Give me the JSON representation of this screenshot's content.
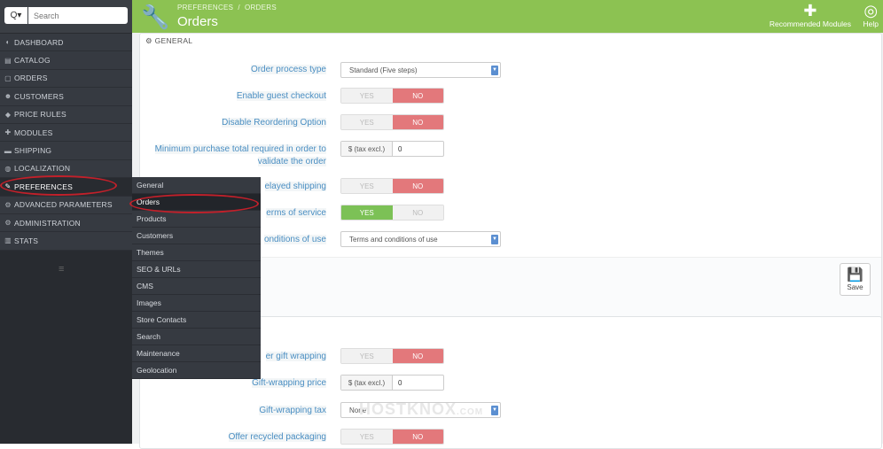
{
  "search": {
    "placeholder": "Search",
    "toggle": "Q▾"
  },
  "sidebar": {
    "items": [
      {
        "label": "DASHBOARD",
        "icon": "dashboard-icon",
        "glyph": "◐"
      },
      {
        "label": "CATALOG",
        "icon": "catalog-icon",
        "glyph": "▤"
      },
      {
        "label": "ORDERS",
        "icon": "orders-icon",
        "glyph": "▢"
      },
      {
        "label": "CUSTOMERS",
        "icon": "customers-icon",
        "glyph": "☻"
      },
      {
        "label": "PRICE RULES",
        "icon": "price-rules-icon",
        "glyph": "◆"
      },
      {
        "label": "MODULES",
        "icon": "modules-icon",
        "glyph": "✚"
      },
      {
        "label": "SHIPPING",
        "icon": "shipping-icon",
        "glyph": "▬"
      },
      {
        "label": "LOCALIZATION",
        "icon": "globe-icon",
        "glyph": "◍"
      },
      {
        "label": "PREFERENCES",
        "icon": "wrench-icon",
        "glyph": "🔧"
      },
      {
        "label": "ADVANCED PARAMETERS",
        "icon": "cogs-icon",
        "glyph": "⚙"
      },
      {
        "label": "ADMINISTRATION",
        "icon": "cog-icon",
        "glyph": "⚙"
      },
      {
        "label": "STATS",
        "icon": "stats-icon",
        "glyph": "▥"
      }
    ],
    "collapse": "≡"
  },
  "submenu": [
    "General",
    "Orders",
    "Products",
    "Customers",
    "Themes",
    "SEO & URLs",
    "CMS",
    "Images",
    "Store Contacts",
    "Search",
    "Maintenance",
    "Geolocation"
  ],
  "header": {
    "breadcrumb_1": "PREFERENCES",
    "breadcrumb_sep": "/",
    "breadcrumb_2": "ORDERS",
    "title": "Orders",
    "recommended": "Recommended Modules",
    "help": "Help",
    "accent": "#8cc252"
  },
  "general": {
    "heading": "GENERAL",
    "order_process_label": "Order process type",
    "order_process_value": "Standard (Five steps)",
    "guest_checkout_label": "Enable guest checkout",
    "reordering_label": "Disable Reordering Option",
    "min_purchase_label": "Minimum purchase total required in order to validate the order",
    "min_purchase_prefix": "$ (tax excl.)",
    "min_purchase_value": "0",
    "delayed_label": "elayed shipping",
    "terms_label": "erms of service",
    "conditions_label": "onditions of use",
    "conditions_value": "Terms and conditions of use",
    "save": "Save"
  },
  "gift": {
    "gift_wrap_label": "er gift wrapping",
    "gift_price_label": "Gift-wrapping price",
    "gift_price_prefix": "$ (tax excl.)",
    "gift_price_value": "0",
    "gift_tax_label": "Gift-wrapping tax",
    "gift_tax_value": "None",
    "recycled_label": "Offer recycled packaging"
  },
  "toggle": {
    "yes": "YES",
    "no": "NO"
  },
  "watermark": {
    "text": "HOSTKNOX",
    "suffix": ".COM"
  }
}
